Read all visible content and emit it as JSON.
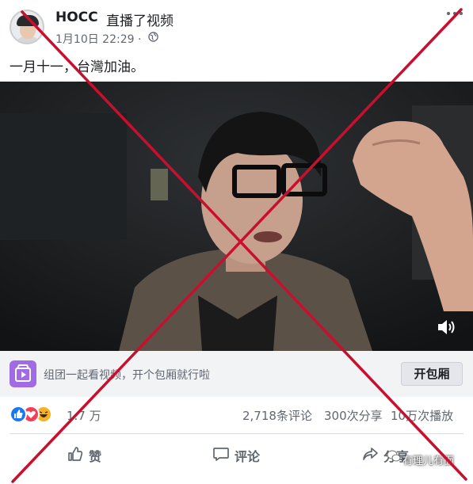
{
  "post": {
    "author": "HOCC",
    "action": "直播了视频",
    "timestamp": "1月10日 22:29 ·",
    "privacy_icon": "globe-icon",
    "text": "一月十一，台灣加油。"
  },
  "video": {
    "volume_icon": "speaker-icon"
  },
  "watch_party": {
    "text": "组团一起看视频，开个包厢就行啦",
    "button": "开包厢"
  },
  "stats": {
    "reaction_icons": [
      "like-icon",
      "love-icon",
      "haha-icon"
    ],
    "reactions": "1.7 万",
    "comments": "2,718条评论",
    "shares": "300次分享",
    "views": "10万次播放"
  },
  "actions": {
    "like": "赞",
    "comment": "评论",
    "share": "分享"
  },
  "watermark": "有理儿有面",
  "colors": {
    "cross": "#c8102e",
    "like_blue": "#1877f2",
    "love_red": "#f33e58",
    "haha_yellow": "#f7b125",
    "party_purple": "#a06be4"
  }
}
